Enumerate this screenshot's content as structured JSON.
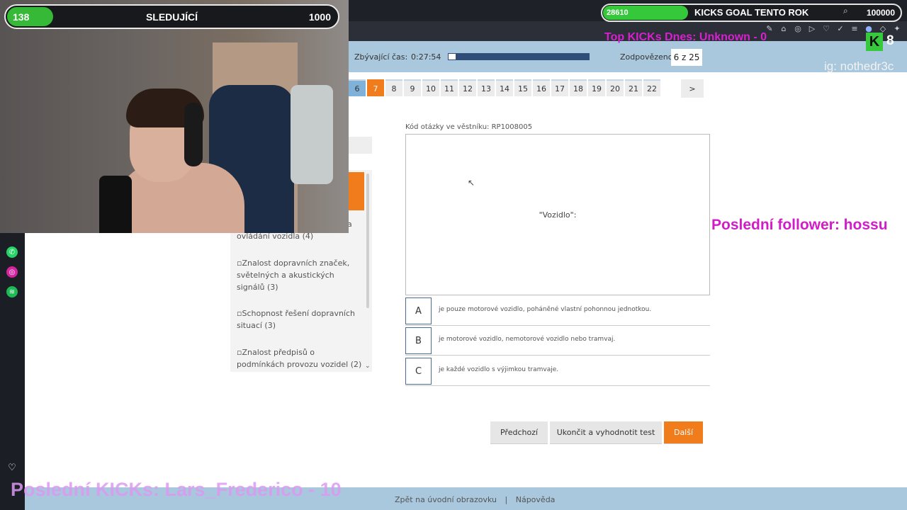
{
  "stream": {
    "follow_goal": {
      "current": "138",
      "title": "SLEDUJÍCÍ",
      "goal": "1000",
      "progress": 0.138
    },
    "kicks_goal": {
      "current": "28610",
      "title": "KICKS GOAL TENTO ROK",
      "goal": "100000",
      "progress": 0.286
    },
    "top_kicks": "Top KICKs Dnes: Unknown - 0",
    "kick_count": "8",
    "kick_logo": "K",
    "instagram": "ig: nothedr3c",
    "last_follower": "Poslední follower: hossu",
    "last_kicks": "Poslední KICKs: Lars_Frederico - 10"
  },
  "test": {
    "time_label": "Zbývající čas:",
    "time_value": "0:27:54",
    "time_remaining_fraction": 0.05,
    "answered_label": "Zodpovězeno",
    "answered_value": "6 z 25",
    "question_numbers": [
      "6",
      "7",
      "8",
      "9",
      "10",
      "11",
      "12",
      "13",
      "14",
      "15",
      "16",
      "17",
      "18",
      "19",
      "20",
      "21",
      "22"
    ],
    "answered_questions": [
      "6"
    ],
    "current_question": "7",
    "next_label": ">",
    "question_code": "Kód otázky ve věstníku: RP1008005",
    "question_text": "\"Vozidlo\":",
    "answers": [
      {
        "letter": "A",
        "text": "je pouze motorové vozidlo, poháněné vlastní pohonnou jednotkou."
      },
      {
        "letter": "B",
        "text": "je motorové vozidlo, nemotorové vozidlo nebo tramvaj."
      },
      {
        "letter": "C",
        "text": "je každé vozidlo s výjimkou tramvaje."
      }
    ],
    "buttons": {
      "prev": "Předchozí",
      "finish": "Ukončit a vyhodnotit test",
      "next": "Další"
    },
    "categories": [
      "ovládání vozidla (4)",
      "Znalost dopravních značek, světelných a akustických signálů (3)",
      "Schopnost řešení dopravních situací (3)",
      "Znalost předpisů o podmínkách provozu vozidel (2)"
    ],
    "category_cut_letter": "a",
    "footer": {
      "home": "Zpět na úvodní obrazovku",
      "separator": "|",
      "help": "Nápověda"
    }
  },
  "colors": {
    "accent": "#f07c1c",
    "blue": "#a9c7dd",
    "answered": "#7fb1d9",
    "magenta": "#d81fd2",
    "kick_green": "#35c83a"
  }
}
